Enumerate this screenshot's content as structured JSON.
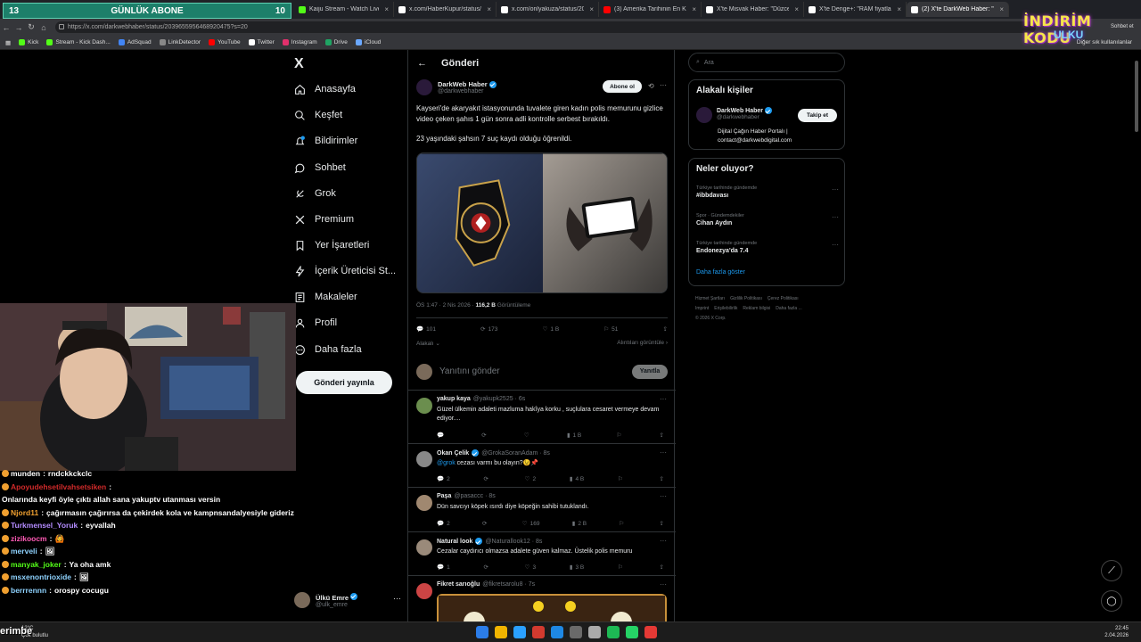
{
  "browser": {
    "tabs": [
      {
        "label": "Kaiju Stream - Watch Live on Ki",
        "color": "#53fc18"
      },
      {
        "label": "x.com/HaberKupur/status/20393...",
        "color": "#ffffff"
      },
      {
        "label": "x.com/onlyakuza/status/2039368...",
        "color": "#ffffff"
      },
      {
        "label": "(3) Amerika Tarihinin En Kanlı Liv...",
        "color": "#ff0000"
      },
      {
        "label": "X'te Misvak Haber: \"Düzce'de gı...",
        "color": "#ffffff"
      },
      {
        "label": "X'te Denge+: \"RAM fiyatlarının a...",
        "color": "#ffffff"
      },
      {
        "label": "(2) X'te DarkWeb Haber: \"Kayse...",
        "color": "#ffffff"
      }
    ],
    "url": "https://x.com/darkwebhaber/status/2039655956468920475?s=20",
    "bookmarks": [
      "Kick",
      "Stream - Kick Dash...",
      "AdSquad",
      "LinkDetector",
      "YouTube",
      "Twitter",
      "Instagram",
      "Drive",
      "iCloud"
    ],
    "bookmark_colors": [
      "#53fc18",
      "#53fc18",
      "#4285f4",
      "#888888",
      "#ff0000",
      "#ffffff",
      "#e1306c",
      "#1fa463",
      "#6aa8ff"
    ],
    "other_bookmarks": "Diğer sık kullanılanlar"
  },
  "overlay": {
    "abone_left": "13",
    "abone_title": "GÜNLÜK ABONE",
    "abone_right": "10",
    "discount_line1": "İNDİRİM KODU",
    "discount_line2": "ULKU",
    "sohbet_et": "Sohbet et"
  },
  "nav": {
    "logo": "X",
    "items": [
      {
        "label": "Anasayfa",
        "icon": "home-icon"
      },
      {
        "label": "Keşfet",
        "icon": "search-icon"
      },
      {
        "label": "Bildirimler",
        "icon": "bell-icon"
      },
      {
        "label": "Sohbet",
        "icon": "chat-icon"
      },
      {
        "label": "Grok",
        "icon": "grok-icon"
      },
      {
        "label": "Premium",
        "icon": "x-premium-icon"
      },
      {
        "label": "Yer İşaretleri",
        "icon": "bookmark-icon"
      },
      {
        "label": "İçerik Üreticisi St...",
        "icon": "bolt-icon"
      },
      {
        "label": "Makaleler",
        "icon": "article-icon"
      },
      {
        "label": "Profil",
        "icon": "user-icon"
      },
      {
        "label": "Daha fazla",
        "icon": "more-circle-icon"
      }
    ],
    "post_button": "Gönderi yayınla",
    "account_name": "Ülkü Emre",
    "account_handle": "@ulk_emre"
  },
  "chat": [
    {
      "user": "munden",
      "color": "#ffffff",
      "text": "rndckkckclc"
    },
    {
      "user": "Apoyudehsetilvahsetsiken",
      "color": "#d12a2a",
      "text": "Onlarında keyfi öyle çıktı allah sana yakuptv utanması versin"
    },
    {
      "user": "Njord11",
      "color": "#f0a030",
      "text": "çağırmasın çağırırsa da çekirdek kola ve kampnsandalyesiyle gideriz"
    },
    {
      "user": "Turkmensel_Yoruk",
      "color": "#b48cff",
      "text": "eyvallah"
    },
    {
      "user": "zizikoocm",
      "color": "#ff5ab5",
      "text": "🙆"
    },
    {
      "user": "merveli",
      "color": "#8fd3ff",
      "text": "🖼"
    },
    {
      "user": "manyak_joker",
      "color": "#53fc18",
      "text": "Ya oha amk"
    },
    {
      "user": "msxenontrioxide",
      "color": "#8fd3ff",
      "text": "🖼"
    },
    {
      "user": "berrrennn",
      "color": "#8fd3ff",
      "text": "orospy cocugu"
    }
  ],
  "main": {
    "header_title": "Gönderi",
    "author_name": "DarkWeb Haber",
    "author_handle": "@darkwebhaber",
    "subscribe": "Abone ol",
    "text_p1": "Kayseri'de akaryakıt istasyonunda tuvalete giren kadın polis memurunu gizlice video çeken şahıs 1 gün sonra adli kontrolle serbest bırakıldı.",
    "text_p2": "23 yaşındaki şahsın 7 suç kaydı olduğu öğrenildi.",
    "meta_time": "ÖS 1:47 · 2 Nis 2026 · ",
    "meta_views": "116,2 B",
    "meta_views_label": " Görüntüleme",
    "stats": {
      "replies": "101",
      "reposts": "173",
      "likes": "1 B",
      "bookmarks": "51"
    },
    "sort_label": "Alakalı",
    "quotes_label": "Alıntıları görüntüle",
    "reply_placeholder": "Yanıtını gönder",
    "reply_button": "Yanıtla"
  },
  "replies": [
    {
      "name": "yakup kaya",
      "handle": "@yakupk2525 · 6s",
      "verified": false,
      "text": "Güzel ülkemin adaleti mazluma hakîya korku , suçlulara cesaret vermeye devam ediyor....",
      "stats": [
        "",
        "",
        "",
        "1 B",
        "",
        ""
      ],
      "avatar": "#6b8e4e"
    },
    {
      "name": "Okan Çelik",
      "handle": "@GrokaSoranAdam · 8s",
      "verified": true,
      "mention": "@grok",
      "text": " cezası varmı bu olayın?😉📌",
      "stats": [
        "2",
        "",
        "2",
        "4 B",
        "",
        ""
      ],
      "avatar": "#888888"
    },
    {
      "name": "Paşa",
      "handle": "@pasaccc · 8s",
      "verified": false,
      "text": "Dün savcıyı köpek ısırdı diye köpeğin sahibi tutuklandı.",
      "stats": [
        "2",
        "",
        "169",
        "2 B",
        "",
        ""
      ],
      "avatar": "#a08870"
    },
    {
      "name": "Natural look",
      "handle": "@Naturallook12 · 8s",
      "verified": true,
      "text": "Cezalar caydırıcı olmazsa adalete güven kalmaz. Üstelik polis memuru",
      "stats": [
        "1",
        "",
        "3",
        "3 B",
        "",
        ""
      ],
      "avatar": "#9a8a7a"
    },
    {
      "name": "Fikret sarıoğlu",
      "handle": "@fikretsarolu8 · 7s",
      "verified": false,
      "text": "",
      "stats": [],
      "avatar": "#c44"
    }
  ],
  "right": {
    "search_placeholder": "Ara",
    "relevant_title": "Alakalı kişiler",
    "person_name": "DarkWeb Haber",
    "person_handle": "@darkwebhaber",
    "person_bio": "Dijital Çağın Haber Portalı | contact@darkwebdigital.com",
    "follow": "Takip et",
    "trends_title": "Neler oluyor?",
    "trends": [
      {
        "meta": "Türkiye tarihinde gündemde",
        "name": "#ibbdavası"
      },
      {
        "meta": "Spor · Gündemdekiler",
        "name": "Cihan Aydın"
      },
      {
        "meta": "Türkiye tarihinde gündemde",
        "name": "Endonezya'da 7.4"
      }
    ],
    "show_more": "Daha fazla göster",
    "footer": [
      "Hizmet Şartları",
      "Gizlilik Politikası",
      "Çerez Politikası",
      "Imprint",
      "Erişilebilirlik",
      "Reklam bilgisi",
      "Daha fazla ...",
      "© 2026 X Corp."
    ]
  },
  "taskbar": {
    "weather_temp": "12°C",
    "weather_desc": "Çok bulutlu",
    "time": "22:45",
    "date": "2.04.2026",
    "streamer": "erimbe",
    "icon_colors": [
      "#2b7de9",
      "#f0b400",
      "#2aa0ff",
      "#d33a2f",
      "#1e88e5",
      "#6a6a6a",
      "#aaa",
      "#1db954",
      "#25d366",
      "#e53935"
    ]
  }
}
